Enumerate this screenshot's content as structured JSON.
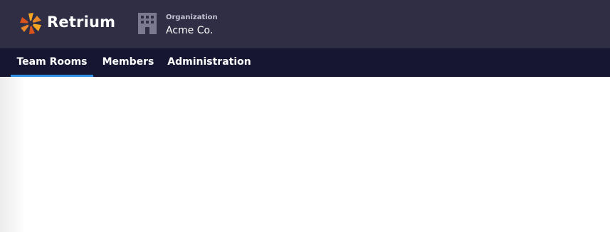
{
  "brand": {
    "name": "Retrium",
    "logo_icon": "retrium-logo-icon",
    "logo_colors": [
      "#f5a623",
      "#e8882a",
      "#d9531e"
    ]
  },
  "organization": {
    "caption": "Organization",
    "name": "Acme Co.",
    "icon": "building-icon"
  },
  "nav": {
    "tabs": [
      {
        "label": "Team Rooms",
        "active": true
      },
      {
        "label": "Members",
        "active": false
      },
      {
        "label": "Administration",
        "active": false
      }
    ]
  },
  "colors": {
    "header_bg": "#2f2e45",
    "nav_bg": "#161633",
    "accent": "#2d8fe6"
  }
}
